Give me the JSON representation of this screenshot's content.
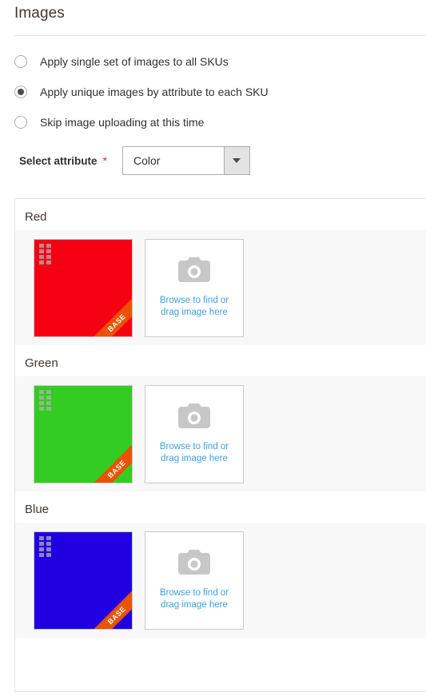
{
  "section": {
    "title": "Images"
  },
  "image_mode": {
    "options": [
      {
        "label": "Apply single set of images to all SKUs",
        "selected": false
      },
      {
        "label": "Apply unique images by attribute to each SKU",
        "selected": true
      },
      {
        "label": "Skip image uploading at this time",
        "selected": false
      }
    ]
  },
  "attribute_select": {
    "label": "Select attribute",
    "required_marker": "*",
    "value": "Color",
    "options": [
      "Color"
    ],
    "dropdown_icon": "chevron-down-icon"
  },
  "gallery": {
    "groups": [
      {
        "title": "Red",
        "swatch_color": "#f50012",
        "badge": "BASE",
        "drag_icon": "drag-handle-icon",
        "upload": {
          "icon": "camera-icon",
          "line1": "Browse to find or",
          "line2": "drag image here"
        }
      },
      {
        "title": "Green",
        "swatch_color": "#33cc22",
        "badge": "BASE",
        "drag_icon": "drag-handle-icon",
        "upload": {
          "icon": "camera-icon",
          "line1": "Browse to find or",
          "line2": "drag image here"
        }
      },
      {
        "title": "Blue",
        "swatch_color": "#2000e0",
        "badge": "BASE",
        "drag_icon": "drag-handle-icon",
        "upload": {
          "icon": "camera-icon",
          "line1": "Browse to find or",
          "line2": "drag image here"
        }
      }
    ]
  },
  "colors": {
    "accent_orange": "#eb5202",
    "link_blue": "#3aa2e0",
    "required_red": "#e22626",
    "text_dark": "#303030",
    "heading": "#41362f",
    "strip_bg": "#f8f8f8",
    "border": "#e3e3e3"
  }
}
